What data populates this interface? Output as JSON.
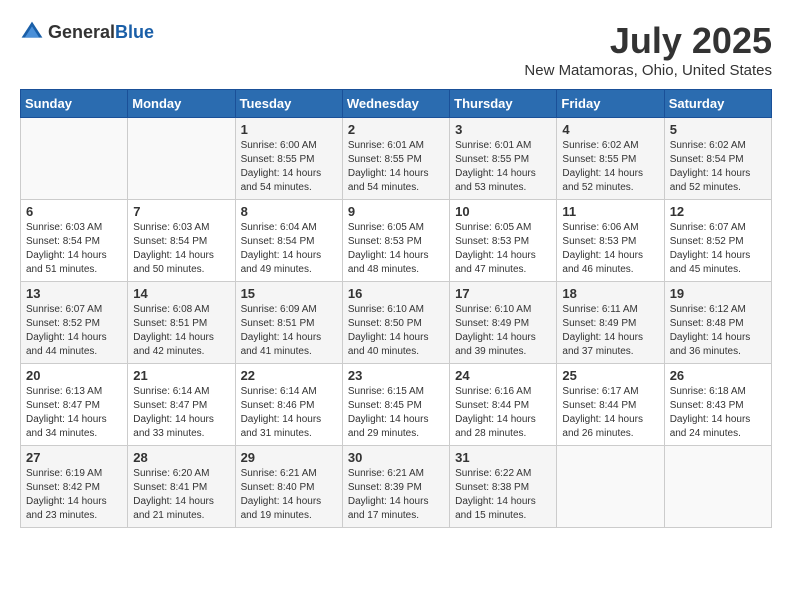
{
  "header": {
    "logo_general": "General",
    "logo_blue": "Blue",
    "title": "July 2025",
    "location": "New Matamoras, Ohio, United States"
  },
  "weekdays": [
    "Sunday",
    "Monday",
    "Tuesday",
    "Wednesday",
    "Thursday",
    "Friday",
    "Saturday"
  ],
  "weeks": [
    [
      {
        "day": "",
        "detail": ""
      },
      {
        "day": "",
        "detail": ""
      },
      {
        "day": "1",
        "detail": "Sunrise: 6:00 AM\nSunset: 8:55 PM\nDaylight: 14 hours\nand 54 minutes."
      },
      {
        "day": "2",
        "detail": "Sunrise: 6:01 AM\nSunset: 8:55 PM\nDaylight: 14 hours\nand 54 minutes."
      },
      {
        "day": "3",
        "detail": "Sunrise: 6:01 AM\nSunset: 8:55 PM\nDaylight: 14 hours\nand 53 minutes."
      },
      {
        "day": "4",
        "detail": "Sunrise: 6:02 AM\nSunset: 8:55 PM\nDaylight: 14 hours\nand 52 minutes."
      },
      {
        "day": "5",
        "detail": "Sunrise: 6:02 AM\nSunset: 8:54 PM\nDaylight: 14 hours\nand 52 minutes."
      }
    ],
    [
      {
        "day": "6",
        "detail": "Sunrise: 6:03 AM\nSunset: 8:54 PM\nDaylight: 14 hours\nand 51 minutes."
      },
      {
        "day": "7",
        "detail": "Sunrise: 6:03 AM\nSunset: 8:54 PM\nDaylight: 14 hours\nand 50 minutes."
      },
      {
        "day": "8",
        "detail": "Sunrise: 6:04 AM\nSunset: 8:54 PM\nDaylight: 14 hours\nand 49 minutes."
      },
      {
        "day": "9",
        "detail": "Sunrise: 6:05 AM\nSunset: 8:53 PM\nDaylight: 14 hours\nand 48 minutes."
      },
      {
        "day": "10",
        "detail": "Sunrise: 6:05 AM\nSunset: 8:53 PM\nDaylight: 14 hours\nand 47 minutes."
      },
      {
        "day": "11",
        "detail": "Sunrise: 6:06 AM\nSunset: 8:53 PM\nDaylight: 14 hours\nand 46 minutes."
      },
      {
        "day": "12",
        "detail": "Sunrise: 6:07 AM\nSunset: 8:52 PM\nDaylight: 14 hours\nand 45 minutes."
      }
    ],
    [
      {
        "day": "13",
        "detail": "Sunrise: 6:07 AM\nSunset: 8:52 PM\nDaylight: 14 hours\nand 44 minutes."
      },
      {
        "day": "14",
        "detail": "Sunrise: 6:08 AM\nSunset: 8:51 PM\nDaylight: 14 hours\nand 42 minutes."
      },
      {
        "day": "15",
        "detail": "Sunrise: 6:09 AM\nSunset: 8:51 PM\nDaylight: 14 hours\nand 41 minutes."
      },
      {
        "day": "16",
        "detail": "Sunrise: 6:10 AM\nSunset: 8:50 PM\nDaylight: 14 hours\nand 40 minutes."
      },
      {
        "day": "17",
        "detail": "Sunrise: 6:10 AM\nSunset: 8:49 PM\nDaylight: 14 hours\nand 39 minutes."
      },
      {
        "day": "18",
        "detail": "Sunrise: 6:11 AM\nSunset: 8:49 PM\nDaylight: 14 hours\nand 37 minutes."
      },
      {
        "day": "19",
        "detail": "Sunrise: 6:12 AM\nSunset: 8:48 PM\nDaylight: 14 hours\nand 36 minutes."
      }
    ],
    [
      {
        "day": "20",
        "detail": "Sunrise: 6:13 AM\nSunset: 8:47 PM\nDaylight: 14 hours\nand 34 minutes."
      },
      {
        "day": "21",
        "detail": "Sunrise: 6:14 AM\nSunset: 8:47 PM\nDaylight: 14 hours\nand 33 minutes."
      },
      {
        "day": "22",
        "detail": "Sunrise: 6:14 AM\nSunset: 8:46 PM\nDaylight: 14 hours\nand 31 minutes."
      },
      {
        "day": "23",
        "detail": "Sunrise: 6:15 AM\nSunset: 8:45 PM\nDaylight: 14 hours\nand 29 minutes."
      },
      {
        "day": "24",
        "detail": "Sunrise: 6:16 AM\nSunset: 8:44 PM\nDaylight: 14 hours\nand 28 minutes."
      },
      {
        "day": "25",
        "detail": "Sunrise: 6:17 AM\nSunset: 8:44 PM\nDaylight: 14 hours\nand 26 minutes."
      },
      {
        "day": "26",
        "detail": "Sunrise: 6:18 AM\nSunset: 8:43 PM\nDaylight: 14 hours\nand 24 minutes."
      }
    ],
    [
      {
        "day": "27",
        "detail": "Sunrise: 6:19 AM\nSunset: 8:42 PM\nDaylight: 14 hours\nand 23 minutes."
      },
      {
        "day": "28",
        "detail": "Sunrise: 6:20 AM\nSunset: 8:41 PM\nDaylight: 14 hours\nand 21 minutes."
      },
      {
        "day": "29",
        "detail": "Sunrise: 6:21 AM\nSunset: 8:40 PM\nDaylight: 14 hours\nand 19 minutes."
      },
      {
        "day": "30",
        "detail": "Sunrise: 6:21 AM\nSunset: 8:39 PM\nDaylight: 14 hours\nand 17 minutes."
      },
      {
        "day": "31",
        "detail": "Sunrise: 6:22 AM\nSunset: 8:38 PM\nDaylight: 14 hours\nand 15 minutes."
      },
      {
        "day": "",
        "detail": ""
      },
      {
        "day": "",
        "detail": ""
      }
    ]
  ]
}
